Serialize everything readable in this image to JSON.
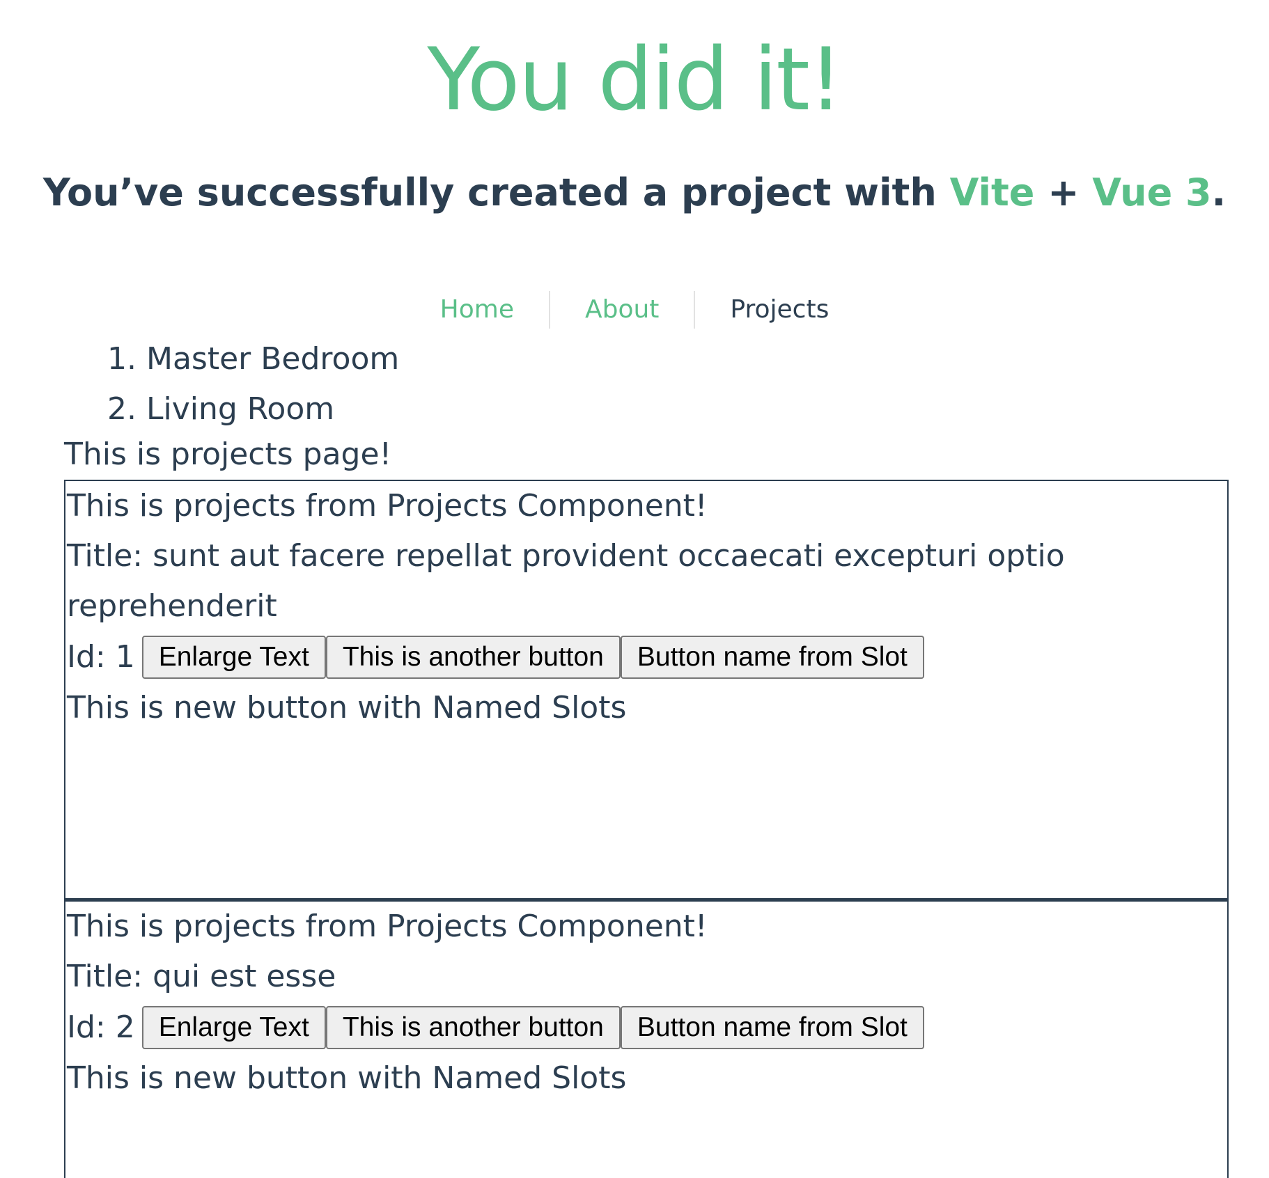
{
  "hero": {
    "title": "You did it!",
    "subtitle_prefix": "You’ve successfully created a project with ",
    "link_vite": "Vite",
    "plus": " + ",
    "link_vue": "Vue 3",
    "suffix": "."
  },
  "nav": {
    "items": [
      {
        "label": "Home"
      },
      {
        "label": "About"
      },
      {
        "label": "Projects"
      }
    ]
  },
  "rooms": [
    "Master Bedroom",
    "Living Room"
  ],
  "page_text": "This is projects page!",
  "projects": [
    {
      "heading": "This is projects from Projects Component!",
      "title": "Title: sunt aut facere repellat provident occaecati excepturi optio reprehenderit",
      "id_label": "Id: 1",
      "buttons": [
        "Enlarge Text",
        "This is another button",
        "Button name from Slot"
      ],
      "named_slot_text": "This is new button with Named Slots"
    },
    {
      "heading": "This is projects from Projects Component!",
      "title": "Title: qui est esse",
      "id_label": "Id: 2",
      "buttons": [
        "Enlarge Text",
        "This is another button",
        "Button name from Slot"
      ],
      "named_slot_text": "This is new button with Named Slots"
    }
  ]
}
